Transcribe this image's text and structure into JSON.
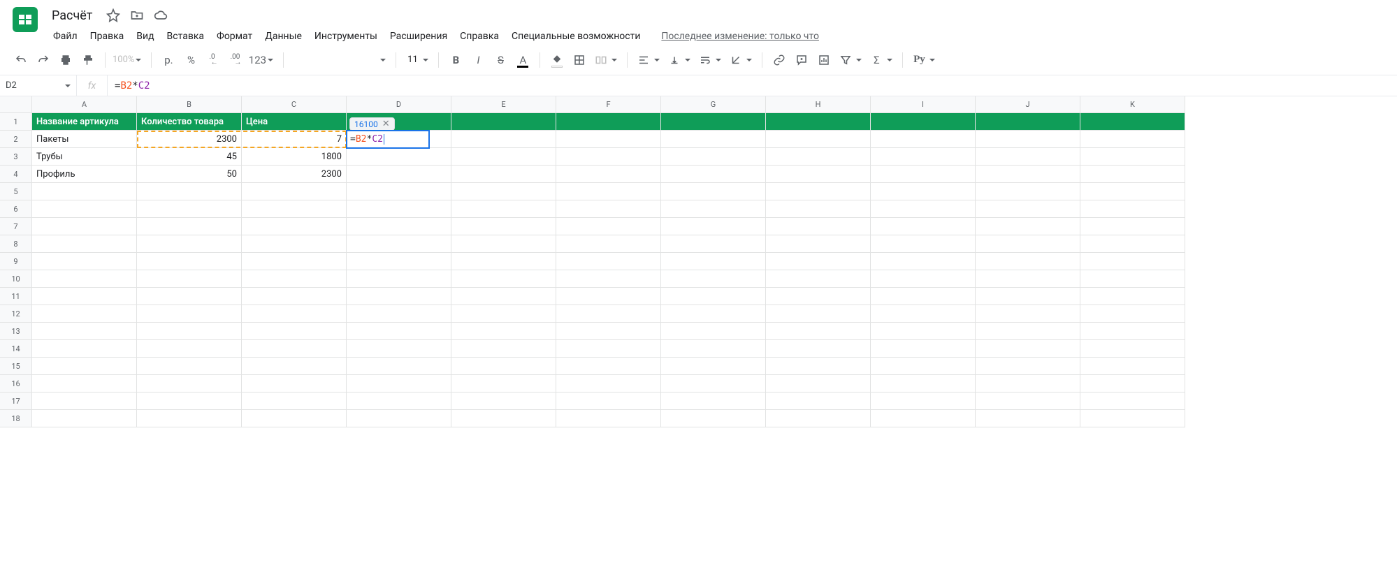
{
  "doc": {
    "title": "Расчёт"
  },
  "menus": [
    "Файл",
    "Правка",
    "Вид",
    "Вставка",
    "Формат",
    "Данные",
    "Инструменты",
    "Расширения",
    "Справка",
    "Специальные возможности"
  ],
  "last_change": "Последнее изменение: только что",
  "toolbar": {
    "zoom": "100%",
    "currency": "р.",
    "percent": "%",
    "dec_less": ".0",
    "dec_more": ".00",
    "num_more": "123",
    "font_size": "11",
    "py": "Py"
  },
  "namebox": "D2",
  "formula": {
    "eq": "=",
    "b2": "B2",
    "op": "*",
    "c2": "C2"
  },
  "result_tip": "16100",
  "columns": [
    "A",
    "B",
    "C",
    "D",
    "E",
    "F",
    "G",
    "H",
    "I",
    "J",
    "K"
  ],
  "header_row": [
    "Название артикула",
    "Количество товара",
    "Цена",
    "",
    "",
    "",
    "",
    "",
    "",
    "",
    ""
  ],
  "rows": [
    {
      "a": "Пакеты",
      "b": "2300",
      "c": "7"
    },
    {
      "a": "Трубы",
      "b": "45",
      "c": "1800"
    },
    {
      "a": "Профиль",
      "b": "50",
      "c": "2300"
    }
  ],
  "row_count": 18
}
